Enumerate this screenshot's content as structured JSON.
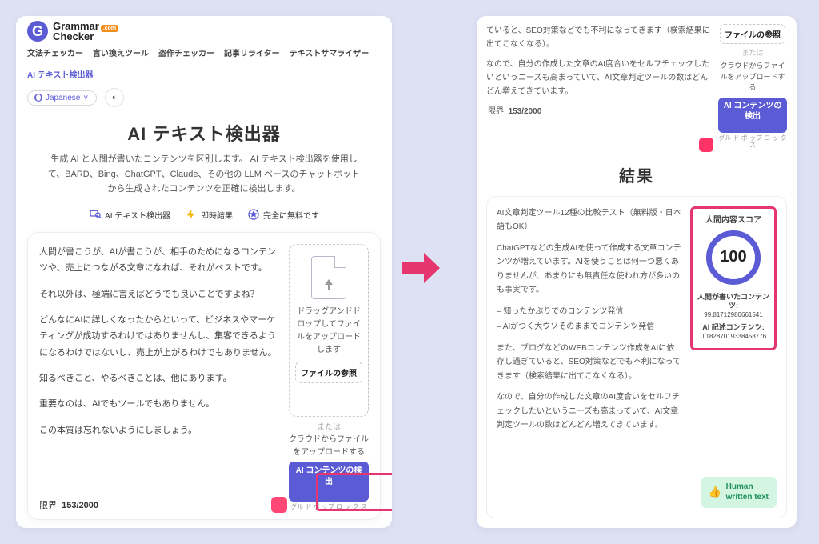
{
  "brand": {
    "name_main": "Grammar",
    "name_sub": "Checker",
    "badge": ".com"
  },
  "nav": {
    "items": [
      "文法チェッカー",
      "言い換えツール",
      "盗作チェッカー",
      "記事リライター",
      "テキストサマライザー",
      "AI テキスト検出器"
    ],
    "active_index": 5
  },
  "lang_selector": {
    "label": "Japanese",
    "caret": "˅"
  },
  "hero": {
    "title": "AI テキスト検出器",
    "desc": "生成 AI と人間が書いたコンテンツを区別します。 AI テキスト検出器を使用して、BARD、Bing、ChatGPT、Claude、その他の LLM ベースのチャットボットから生成されたコンテンツを正確に検出します。"
  },
  "features": [
    {
      "icon": "search",
      "label": "AI テキスト検出器"
    },
    {
      "icon": "bolt",
      "label": "即時結果"
    },
    {
      "icon": "star",
      "label": "完全に無料です"
    }
  ],
  "input_text": {
    "p1": "人間が書こうが、AIが書こうが、相手のためになるコンテンツや、売上につながる文章になれば、それがベストです。",
    "p2": "それ以外は、極端に言えばどうでも良いことですよね？",
    "p3": "どんなにAIに詳しくなったからといって、ビジネスやマーケティングが成功するわけではありませんし、集客できるようになるわけではないし、売上が上がるわけでもありません。",
    "p4": "知るべきこと、やるべきことは、他にあります。",
    "p5": "重要なのは、AIでもツールでもありません。",
    "p6": "この本質は忘れないようにしましょう。"
  },
  "limit": {
    "label": "限界:",
    "value": "153/2000"
  },
  "upload": {
    "drop_text": "ドラッグアンドドロップしてファイルをアップロードします",
    "browse": "ファイルの参照",
    "or": "または",
    "cloud": "クラウドからファイルをアップロードする",
    "cloud_icons": "グル ド ボ\nップ ロ ッ\nク   ス",
    "detect": "AI コンテンツの検出"
  },
  "right_top": {
    "p1": "ていると、SEO対策などでも不利になってきます（検索結果に出てこなくなる）。",
    "p2": "なので、自分の作成した文章のAI度合いをセルフチェックしたいというニーズも高まっていて、AI文章判定ツールの数はどんどん増えてきています。"
  },
  "results": {
    "title": "結果",
    "p1": "AI文章判定ツール12種の比較テスト（無料版・日本語もOK）",
    "p2": "ChatGPTなどの生成AIを使って作成する文章コンテンツが増えています。AIを使うことは何一つ悪くありませんが、あまりにも無責任な使われ方が多いのも事実です。",
    "b1": "– 知ったかぶりでのコンテンツ発信",
    "b2": "– AIがつく大ウソそのままでコンテンツ発信",
    "p3": "また、ブログなどのWEBコンテンツ作成をAIに依存し過ぎていると、SEO対策などでも不利になってきます（検索結果に出てこなくなる）。",
    "p4": "なので、自分の作成した文章のAI度合いをセルフチェックしたいというニーズも高まっていて、AI文章判定ツールの数はどんどん増えてきています。"
  },
  "score": {
    "title": "人間内容スコア",
    "value": "100",
    "human_label": "人間が書いたコンテンツ:",
    "human_value": "99.81712980661541",
    "ai_label": "AI 記述コンテンツ:",
    "ai_value": "0.18287019338458776"
  },
  "badge": {
    "line1": "Human",
    "line2": "written text"
  }
}
